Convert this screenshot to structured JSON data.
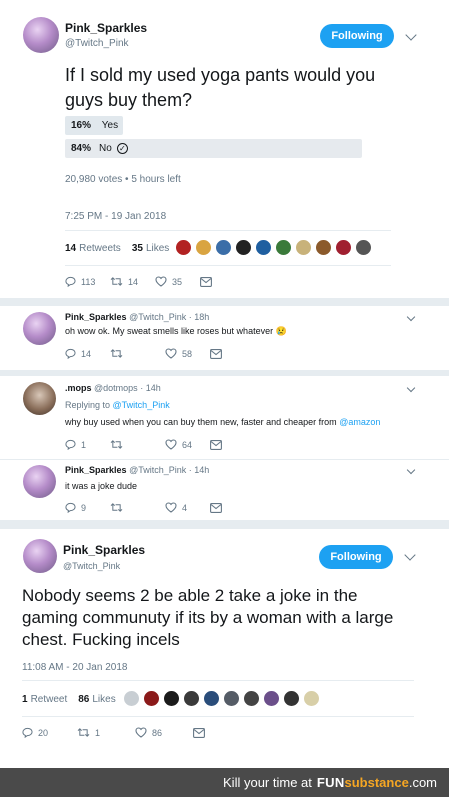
{
  "tweet1": {
    "name": "Pink_Sparkles",
    "handle": "@Twitch_Pink",
    "follow_label": "Following",
    "text": "If I sold my used yoga pants would you guys buy them?",
    "poll": {
      "options": [
        {
          "pct": "16%",
          "label": "Yes",
          "fraction": 0.16
        },
        {
          "pct": "84%",
          "label": "No",
          "fraction": 0.84
        }
      ],
      "meta": "20,980 votes • 5 hours left",
      "check_icon": "check-circle-icon"
    },
    "timestamp": "7:25 PM - 19 Jan 2018",
    "retweets_count": "14",
    "retweets_label": "Retweets",
    "likes_count": "35",
    "likes_label": "Likes",
    "actions": {
      "reply": "113",
      "retweet": "14",
      "like": "35"
    }
  },
  "reply1": {
    "name": "Pink_Sparkles",
    "handle": "@Twitch_Pink",
    "time": "18h",
    "text": "oh wow ok. My sweat smells like roses but whatever",
    "emoji": "😢",
    "actions": {
      "reply": "14",
      "retweet": "",
      "like": "58"
    }
  },
  "reply2": {
    "name": ".mops",
    "handle": "@dotmops",
    "time": "14h",
    "replying_prefix": "Replying to",
    "replying_to": "@Twitch_Pink",
    "text_before": "why buy used when you can buy them new, faster and cheaper from",
    "text_link": "@amazon",
    "actions": {
      "reply": "1",
      "retweet": "",
      "like": "64"
    }
  },
  "reply3": {
    "name": "Pink_Sparkles",
    "handle": "@Twitch_Pink",
    "time": "14h",
    "text": "it was a joke dude",
    "actions": {
      "reply": "9",
      "retweet": "",
      "like": "4"
    }
  },
  "tweet2": {
    "name": "Pink_Sparkles",
    "handle": "@Twitch_Pink",
    "follow_label": "Following",
    "text": "Nobody seems 2 be able 2 take a joke in the gaming communuty if its by a woman with a large chest. Fucking incels",
    "timestamp": "11:08 AM - 20 Jan 2018",
    "retweets_count": "1",
    "retweets_label": "Retweet",
    "likes_count": "86",
    "likes_label": "Likes",
    "actions": {
      "reply": "20",
      "retweet": "1",
      "like": "86"
    }
  },
  "footer": {
    "prefix": "Kill your time at",
    "fun": "FUN",
    "substance": "substance",
    "suffix": ".com"
  },
  "colors": {
    "accent": "#1da1f2",
    "muted": "#657786",
    "divider": "#e6ecf0",
    "footer_bg": "#4a4a4a",
    "footer_accent": "#f5a623"
  }
}
